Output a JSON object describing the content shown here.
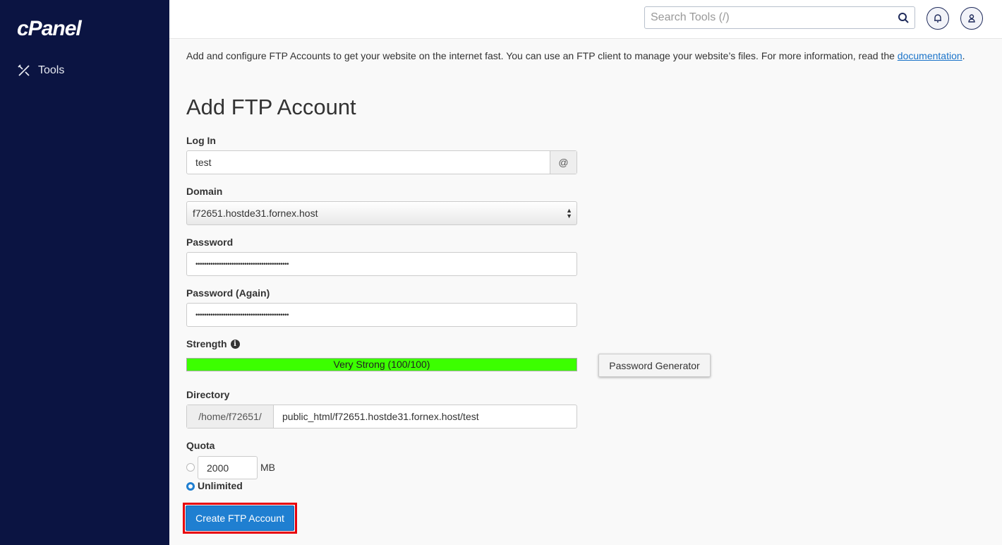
{
  "sidebar": {
    "logo": "cPanel",
    "items": [
      {
        "label": "Tools",
        "icon": "tools-icon"
      }
    ]
  },
  "header": {
    "search_placeholder": "Search Tools (/)",
    "icons": [
      "search-icon",
      "bell-icon",
      "user-icon"
    ]
  },
  "main": {
    "intro": "Add and configure FTP Accounts to get your website on the internet fast. You can use an FTP client to manage your website’s files. For more information, read the ",
    "intro_link": "documentation",
    "intro_end": ".",
    "title": "Add FTP Account",
    "login": {
      "label": "Log In",
      "value": "test",
      "addon": "@"
    },
    "domain": {
      "label": "Domain",
      "value": "f72651.hostde31.fornex.host"
    },
    "password": {
      "label": "Password",
      "value": "••••••••••••••••••••••••••••••••••••••••••••"
    },
    "password_again": {
      "label": "Password (Again)",
      "value": "••••••••••••••••••••••••••••••••••••••••••••"
    },
    "strength": {
      "label": "Strength",
      "text": "Very Strong (100/100)",
      "score": 100,
      "color": "#3cff00"
    },
    "password_generator": "Password Generator",
    "directory": {
      "label": "Directory",
      "prefix": "/home/f72651/",
      "value": "public_html/f72651.hostde31.fornex.host/test"
    },
    "quota": {
      "label": "Quota",
      "value": "2000",
      "unit": "MB",
      "unlimited": "Unlimited",
      "selected": "Unlimited"
    },
    "submit": "Create FTP Account"
  },
  "colors": {
    "sidebar": "#0b1442",
    "primary": "#1f7fd1",
    "highlight": "#e8000b"
  }
}
